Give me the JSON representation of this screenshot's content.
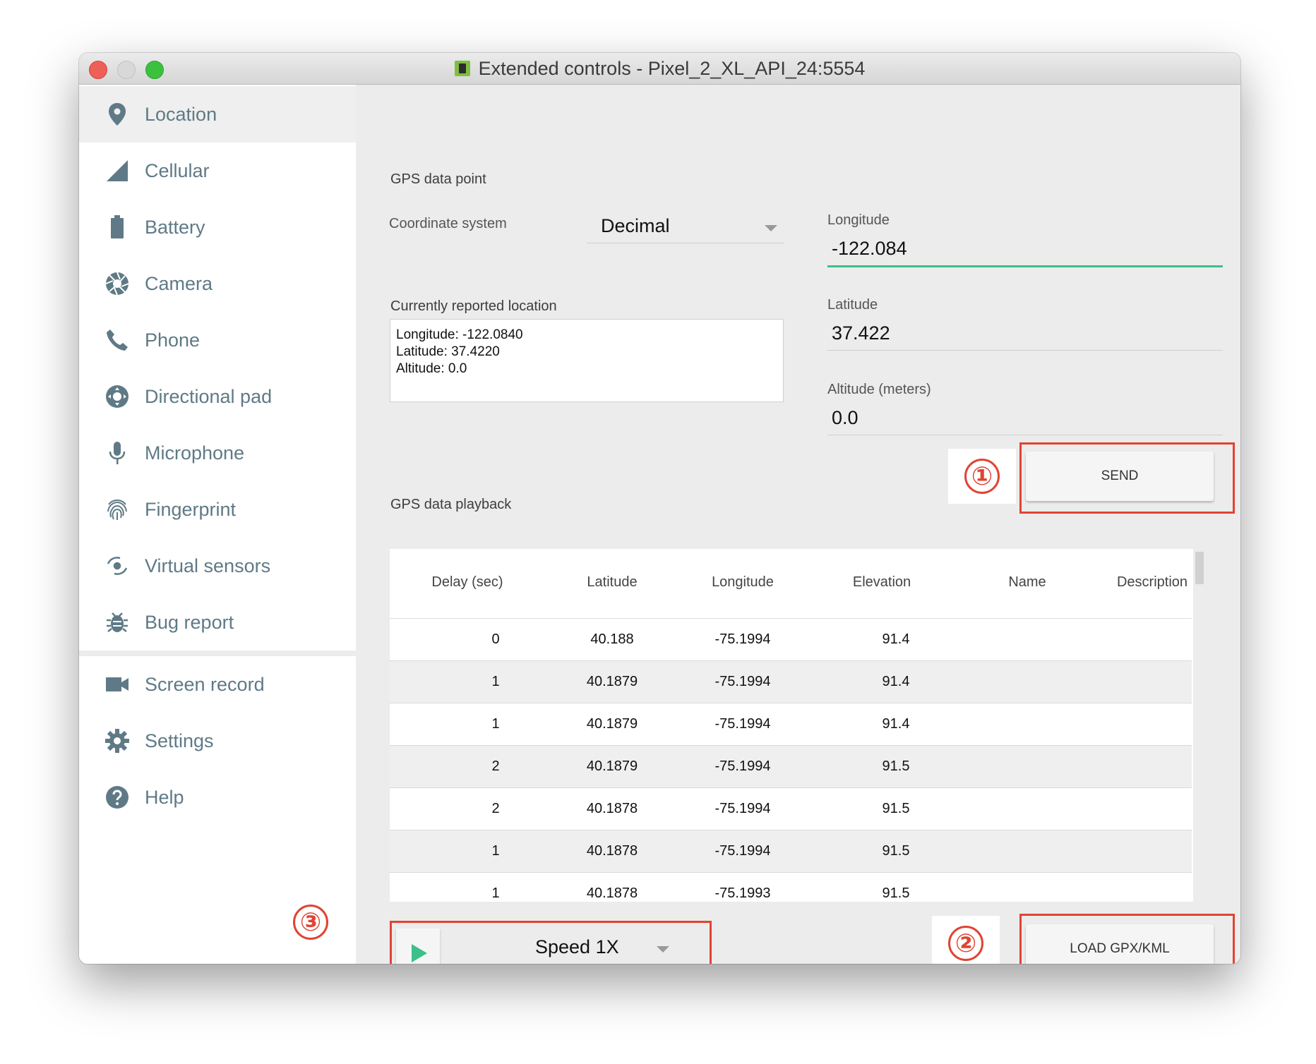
{
  "window": {
    "title": "Extended controls - Pixel_2_XL_API_24:5554"
  },
  "sidebar": {
    "items": [
      {
        "label": "Location",
        "icon": "location-pin-icon",
        "active": true
      },
      {
        "label": "Cellular",
        "icon": "cellular-signal-icon"
      },
      {
        "label": "Battery",
        "icon": "battery-icon"
      },
      {
        "label": "Camera",
        "icon": "camera-aperture-icon"
      },
      {
        "label": "Phone",
        "icon": "phone-icon"
      },
      {
        "label": "Directional pad",
        "icon": "dpad-icon"
      },
      {
        "label": "Microphone",
        "icon": "microphone-icon"
      },
      {
        "label": "Fingerprint",
        "icon": "fingerprint-icon"
      },
      {
        "label": "Virtual sensors",
        "icon": "rotation-icon"
      },
      {
        "label": "Bug report",
        "icon": "bug-icon"
      },
      {
        "label": "Screen record",
        "icon": "video-camera-icon"
      },
      {
        "label": "Settings",
        "icon": "gear-icon"
      },
      {
        "label": "Help",
        "icon": "help-icon"
      }
    ]
  },
  "gps_point": {
    "title": "GPS data point",
    "coord_system_label": "Coordinate system",
    "coord_system_value": "Decimal",
    "longitude_label": "Longitude",
    "longitude_value": "-122.084",
    "latitude_label": "Latitude",
    "latitude_value": "37.422",
    "altitude_label": "Altitude (meters)",
    "altitude_value": "0.0",
    "current_label": "Currently reported location",
    "current_lines": [
      "Longitude: -122.0840",
      "Latitude: 37.4220",
      "Altitude: 0.0"
    ],
    "send_label": "SEND"
  },
  "playback": {
    "title": "GPS data playback",
    "columns": [
      "Delay (sec)",
      "Latitude",
      "Longitude",
      "Elevation",
      "Name",
      "Description"
    ],
    "rows": [
      [
        "0",
        "40.188",
        "-75.1994",
        "91.4",
        "",
        ""
      ],
      [
        "1",
        "40.1879",
        "-75.1994",
        "91.4",
        "",
        ""
      ],
      [
        "1",
        "40.1879",
        "-75.1994",
        "91.4",
        "",
        ""
      ],
      [
        "2",
        "40.1879",
        "-75.1994",
        "91.5",
        "",
        ""
      ],
      [
        "2",
        "40.1878",
        "-75.1994",
        "91.5",
        "",
        ""
      ],
      [
        "1",
        "40.1878",
        "-75.1994",
        "91.5",
        "",
        ""
      ],
      [
        "1",
        "40.1878",
        "-75.1993",
        "91.5",
        "",
        ""
      ]
    ],
    "speed_value": "Speed 1X",
    "load_label": "LOAD GPX/KML"
  },
  "annotations": {
    "one": "①",
    "two": "②",
    "three": "③"
  },
  "colors": {
    "accent": "#3dbf8a",
    "highlight": "#e04433",
    "icon": "#5f7a86"
  }
}
